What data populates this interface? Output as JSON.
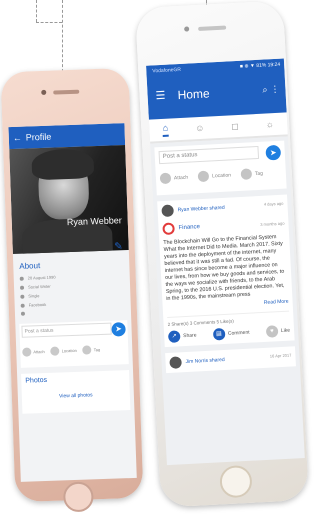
{
  "left_phone": {
    "header": {
      "back": "←",
      "title": "Profile"
    },
    "profile_name": "Ryan Webber",
    "about_title": "About",
    "about_rows": [
      "20 August 1990",
      "Social Writer",
      "Single",
      "Facebook",
      ""
    ],
    "status": {
      "placeholder": "Post a status",
      "send": "➤"
    },
    "actions": [
      "Attach",
      "Location",
      "Tag"
    ],
    "photos": {
      "title": "Photos",
      "view_all": "View all photos"
    }
  },
  "right_phone": {
    "appbar": {
      "brand": "VodafoneGR",
      "status_icons": "■ ⊕ ▼ 81% 19:24",
      "menu_icon": "☰",
      "title": "Home",
      "search_icon": "⌕",
      "more_icon": "⋮"
    },
    "tabs": [
      {
        "label": "⌂",
        "active": true
      },
      {
        "label": "☺",
        "active": false
      },
      {
        "label": "◻",
        "active": false
      },
      {
        "label": "☼",
        "active": false
      }
    ],
    "post_box": {
      "placeholder": "Post a status",
      "send": "➤",
      "actions": [
        "Attach",
        "Location",
        "Tag"
      ]
    },
    "post": {
      "shared_by": "Ryan Webber shared",
      "shared_time": "4 days ago",
      "finance_label": "Finance",
      "finance_time": "3 months ago",
      "body": "The Blockchain Will Go to the Financial System What the Internet Did to Media. March 2017. Sixty years into the deployment of the internet, many believed that it was still a fad. Of course, the internet has since become a major influence on our lives, from how we buy goods and services, to the ways we socialize with friends, to the Arab Spring, to the 2016 U.S. presidential election. Yet, in the 1990s, the mainstream press",
      "read_more": "Read More",
      "stats": "2 Share(s)   3 Comments   5 Like(s)",
      "footer": [
        "Share",
        "Comment",
        "Like"
      ]
    },
    "next_post": {
      "shared_by": "Jim Norris shared",
      "time": "16 Apr 2017"
    }
  }
}
